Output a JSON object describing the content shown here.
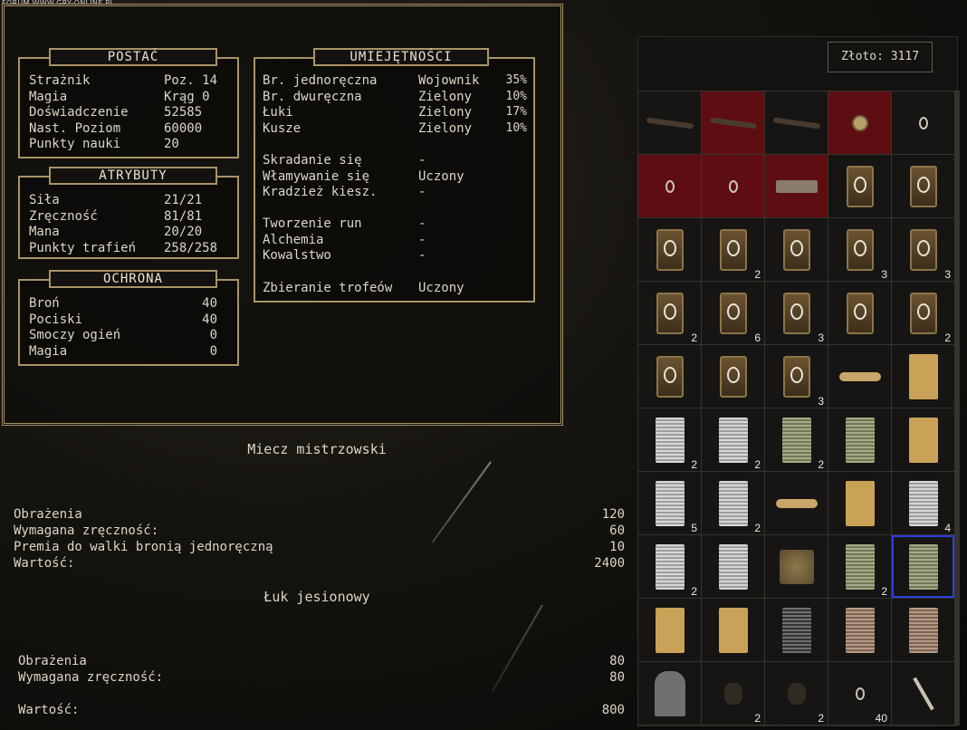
{
  "watermark": "FORUM WWW.GRY-ONLINE.PL",
  "postac": {
    "title": "POSTAĆ",
    "rows": [
      {
        "label": "Strażnik",
        "value": "Poz. 14"
      },
      {
        "label": "Magia",
        "value": "Krąg 0"
      },
      {
        "label": "Doświadczenie",
        "value": "52585"
      },
      {
        "label": "Nast. Poziom",
        "value": "60000"
      },
      {
        "label": "Punkty nauki",
        "value": "20"
      }
    ]
  },
  "atrybuty": {
    "title": "ATRYBUTY",
    "rows": [
      {
        "label": "Siła",
        "value": "21/21"
      },
      {
        "label": "Zręczność",
        "value": "81/81"
      },
      {
        "label": "Mana",
        "value": "20/20"
      },
      {
        "label": "Punkty trafień",
        "value": "258/258"
      }
    ]
  },
  "ochrona": {
    "title": "OCHRONA",
    "rows": [
      {
        "label": "Broń",
        "value": "40"
      },
      {
        "label": "Pociski",
        "value": "40"
      },
      {
        "label": "Smoczy ogień",
        "value": "0"
      },
      {
        "label": "Magia",
        "value": "0"
      }
    ]
  },
  "umiejetnosci": {
    "title": "UMIEJĘTNOŚCI",
    "weapons": [
      {
        "label": "Br. jednoręczna",
        "rank": "Wojownik",
        "pct": "35%"
      },
      {
        "label": "Br. dwuręczna",
        "rank": "Zielony",
        "pct": "10%"
      },
      {
        "label": "Łuki",
        "rank": "Zielony",
        "pct": "17%"
      },
      {
        "label": "Kusze",
        "rank": "Zielony",
        "pct": "10%"
      }
    ],
    "thief": [
      {
        "label": "Skradanie się",
        "value": "-"
      },
      {
        "label": "Włamywanie się",
        "value": "Uczony"
      },
      {
        "label": "Kradzież kiesz.",
        "value": "-"
      }
    ],
    "craft": [
      {
        "label": "Tworzenie run",
        "value": "-"
      },
      {
        "label": "Alchemia",
        "value": "-"
      },
      {
        "label": "Kowalstwo",
        "value": "-"
      }
    ],
    "trophy": {
      "label": "Zbieranie trofeów",
      "value": "Uczony"
    }
  },
  "gold": "Złoto: 3117",
  "inventory": [
    {
      "icon": "weapon-icon",
      "qty": "",
      "equipped": false
    },
    {
      "icon": "weapon-icon",
      "qty": "",
      "equipped": true
    },
    {
      "icon": "weapon-icon",
      "qty": "",
      "equipped": false
    },
    {
      "icon": "amulet-icon",
      "qty": "",
      "equipped": true
    },
    {
      "icon": "ring-icon",
      "qty": "",
      "equipped": false
    },
    {
      "icon": "ring-icon",
      "qty": "",
      "equipped": true
    },
    {
      "icon": "ring-icon",
      "qty": "",
      "equipped": true
    },
    {
      "icon": "belt-icon",
      "qty": "",
      "equipped": true
    },
    {
      "icon": "rune-icon",
      "qty": "",
      "equipped": false
    },
    {
      "icon": "rune-icon",
      "qty": "",
      "equipped": false
    },
    {
      "icon": "rune-icon",
      "qty": "",
      "equipped": false
    },
    {
      "icon": "rune-icon",
      "qty": "2",
      "equipped": false
    },
    {
      "icon": "rune-icon",
      "qty": "",
      "equipped": false
    },
    {
      "icon": "rune-icon",
      "qty": "3",
      "equipped": false
    },
    {
      "icon": "rune-icon",
      "qty": "3",
      "equipped": false
    },
    {
      "icon": "rune-icon",
      "qty": "2",
      "equipped": false
    },
    {
      "icon": "rune-icon",
      "qty": "6",
      "equipped": false
    },
    {
      "icon": "rune-icon",
      "qty": "3",
      "equipped": false
    },
    {
      "icon": "rune-icon",
      "qty": "",
      "equipped": false
    },
    {
      "icon": "rune-icon",
      "qty": "2",
      "equipped": false
    },
    {
      "icon": "rune-icon",
      "qty": "",
      "equipped": false
    },
    {
      "icon": "rune-icon",
      "qty": "",
      "equipped": false
    },
    {
      "icon": "rune-icon",
      "qty": "3",
      "equipped": false
    },
    {
      "icon": "rolled-scroll-icon",
      "qty": "",
      "equipped": false
    },
    {
      "icon": "paper-icon",
      "qty": "",
      "equipped": false
    },
    {
      "icon": "scroll-grey-icon",
      "qty": "2",
      "equipped": false
    },
    {
      "icon": "scroll-grey-icon",
      "qty": "2",
      "equipped": false
    },
    {
      "icon": "scroll-green-icon",
      "qty": "2",
      "equipped": false
    },
    {
      "icon": "scroll-green-icon",
      "qty": "",
      "equipped": false
    },
    {
      "icon": "paper-icon",
      "qty": "",
      "equipped": false
    },
    {
      "icon": "scroll-grey-icon",
      "qty": "5",
      "equipped": false
    },
    {
      "icon": "scroll-grey-icon",
      "qty": "2",
      "equipped": false
    },
    {
      "icon": "rolled-scroll-icon",
      "qty": "",
      "equipped": false
    },
    {
      "icon": "paper-icon",
      "qty": "",
      "equipped": false
    },
    {
      "icon": "scroll-grey-icon",
      "qty": "4",
      "equipped": false
    },
    {
      "icon": "scroll-grey-icon",
      "qty": "2",
      "equipped": false
    },
    {
      "icon": "scroll-grey-icon",
      "qty": "",
      "equipped": false
    },
    {
      "icon": "map-icon",
      "qty": "",
      "equipped": false
    },
    {
      "icon": "scroll-green-icon",
      "qty": "2",
      "equipped": false
    },
    {
      "icon": "scroll-green-icon",
      "qty": "",
      "equipped": false,
      "selected": true
    },
    {
      "icon": "paper-icon",
      "qty": "",
      "equipped": false
    },
    {
      "icon": "paper-icon",
      "qty": "",
      "equipped": false
    },
    {
      "icon": "scroll-dark-icon",
      "qty": "",
      "equipped": false
    },
    {
      "icon": "scroll-brown-icon",
      "qty": "",
      "equipped": false
    },
    {
      "icon": "scroll-brown-icon",
      "qty": "",
      "equipped": false
    },
    {
      "icon": "stone-tablet-icon",
      "qty": "",
      "equipped": false
    },
    {
      "icon": "herb-icon",
      "qty": "2",
      "equipped": false
    },
    {
      "icon": "herb-icon",
      "qty": "2",
      "equipped": false
    },
    {
      "icon": "lockpick-icon",
      "qty": "40",
      "equipped": false
    },
    {
      "icon": "key-icon",
      "qty": "",
      "equipped": false
    }
  ],
  "item1": {
    "title": "Miecz mistrzowski",
    "stats": [
      {
        "label": "Obrażenia",
        "value": "120"
      },
      {
        "label": "Wymagana zręczność:",
        "value": "60"
      },
      {
        "label": "Premia do walki bronią jednoręczną",
        "value": "10"
      },
      {
        "label": "Wartość:",
        "value": "2400"
      }
    ]
  },
  "item2": {
    "title": "Łuk jesionowy",
    "stats": [
      {
        "label": "Obrażenia",
        "value": "80"
      },
      {
        "label": "Wymagana zręczność:",
        "value": "80"
      },
      {
        "label": "Wartość:",
        "value": "800"
      }
    ]
  }
}
